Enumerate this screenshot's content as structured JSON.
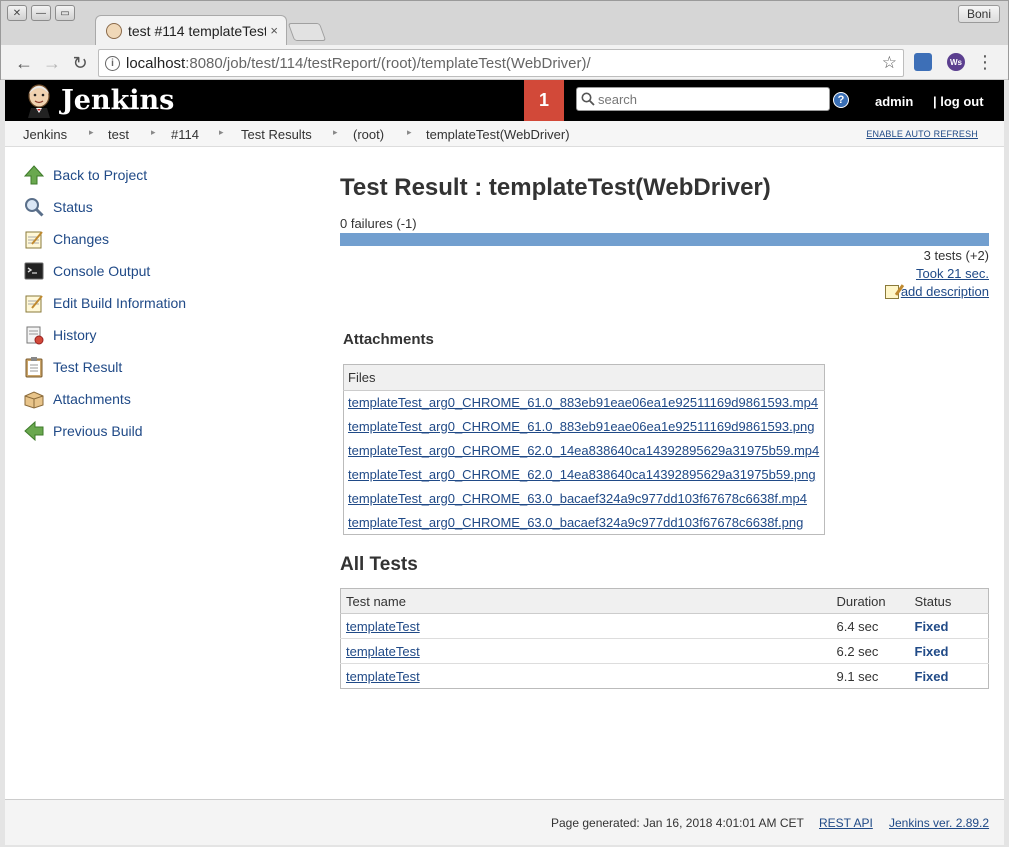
{
  "browser": {
    "tab_title": "test #114 templateTest",
    "tab_close": "×",
    "user": "Boni",
    "url_host": "localhost",
    "url_rest": ":8080/job/test/114/testReport/(root)/templateTest(WebDriver)/",
    "ext1_label": "",
    "ext2_label": "Ws"
  },
  "header": {
    "logo_text": "Jenkins",
    "notification_count": "1",
    "search_placeholder": "search",
    "help_label": "?",
    "user": "admin",
    "logout": "| log out"
  },
  "breadcrumbs": {
    "items": [
      "Jenkins",
      "test",
      "#114",
      "Test Results",
      "(root)",
      "templateTest(WebDriver)"
    ],
    "auto_refresh": "ENABLE AUTO REFRESH"
  },
  "sidebar": {
    "items": [
      {
        "label": "Back to Project",
        "icon": "up-arrow-icon"
      },
      {
        "label": "Status",
        "icon": "magnifier-icon"
      },
      {
        "label": "Changes",
        "icon": "notepad-icon"
      },
      {
        "label": "Console Output",
        "icon": "terminal-icon"
      },
      {
        "label": "Edit Build Information",
        "icon": "notepad-edit-icon"
      },
      {
        "label": "History",
        "icon": "history-icon"
      },
      {
        "label": "Test Result",
        "icon": "clipboard-icon"
      },
      {
        "label": "Attachments",
        "icon": "package-icon"
      },
      {
        "label": "Previous Build",
        "icon": "left-arrow-icon"
      }
    ]
  },
  "main": {
    "title": "Test Result : templateTest(WebDriver)",
    "failures": "0 failures (-1)",
    "pass_ratio": 1.0,
    "tests": "3 tests (+2)",
    "took": "Took 21 sec.",
    "add_description": "add description"
  },
  "attachments": {
    "title": "Attachments",
    "header": "Files",
    "files": [
      "templateTest_arg0_CHROME_61.0_883eb91eae06ea1e92511169d9861593.mp4",
      "templateTest_arg0_CHROME_61.0_883eb91eae06ea1e92511169d9861593.png",
      "templateTest_arg0_CHROME_62.0_14ea838640ca14392895629a31975b59.mp4",
      "templateTest_arg0_CHROME_62.0_14ea838640ca14392895629a31975b59.png",
      "templateTest_arg0_CHROME_63.0_bacaef324a9c977dd103f67678c6638f.mp4",
      "templateTest_arg0_CHROME_63.0_bacaef324a9c977dd103f67678c6638f.png"
    ]
  },
  "all_tests": {
    "title": "All Tests",
    "columns": [
      "Test name",
      "Duration",
      "Status"
    ],
    "rows": [
      {
        "name": "templateTest",
        "duration": "6.4 sec",
        "status": "Fixed"
      },
      {
        "name": "templateTest",
        "duration": "6.2 sec",
        "status": "Fixed"
      },
      {
        "name": "templateTest",
        "duration": "9.1 sec",
        "status": "Fixed"
      }
    ]
  },
  "footer": {
    "generated": "Page generated: Jan 16, 2018 4:01:01 AM CET",
    "rest_api": "REST API",
    "version": "Jenkins ver. 2.89.2"
  },
  "colors": {
    "accent": "#204a87",
    "notification": "#d24939",
    "progress": "#729fcf"
  }
}
